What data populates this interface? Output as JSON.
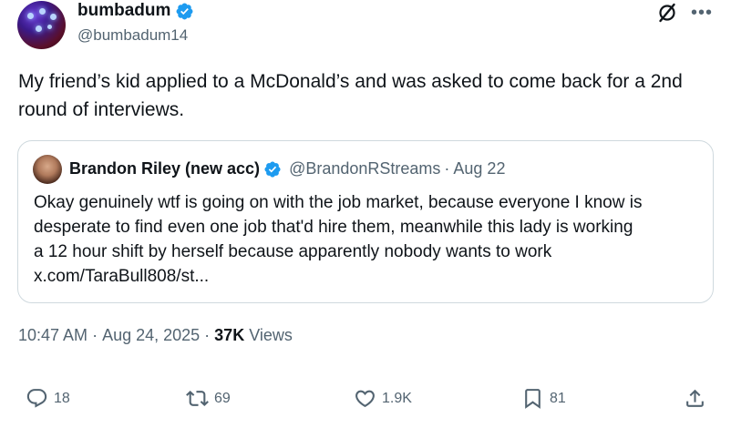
{
  "author": {
    "display_name": "bumbadum",
    "handle": "@bumbadum14",
    "verified": true
  },
  "tweet": {
    "text": "My friend’s kid applied to a McDonald’s and was asked to come back for a 2nd round of interviews."
  },
  "quote": {
    "display_name": "Brandon Riley (new acc)",
    "handle": "@BrandonRStreams",
    "separator": "·",
    "date": "Aug 22",
    "text_lines": [
      "Okay genuinely wtf is going on with the job market, because everyone I know is",
      "desperate to find even one job that'd hire them, meanwhile this lady is working",
      "a 12 hour shift by herself because apparently nobody wants to work",
      "x.com/TaraBull808/st..."
    ]
  },
  "meta": {
    "time": "10:47 AM",
    "sep1": "·",
    "date": "Aug 24, 2025",
    "sep2": "·",
    "views_count": "37K",
    "views_label": "Views"
  },
  "actions": {
    "replies": "18",
    "reposts": "69",
    "likes": "1.9K",
    "bookmarks": "81"
  },
  "icons": {
    "verified": "verified-badge-icon",
    "grok": "grok-icon",
    "more": "more-icon",
    "reply": "reply-icon",
    "repost": "repost-icon",
    "like": "heart-icon",
    "bookmark": "bookmark-icon",
    "share": "share-icon"
  },
  "colors": {
    "verified_blue": "#1d9bf0",
    "text_primary": "#0f1419",
    "text_secondary": "#536471",
    "border": "#cfd9de"
  }
}
